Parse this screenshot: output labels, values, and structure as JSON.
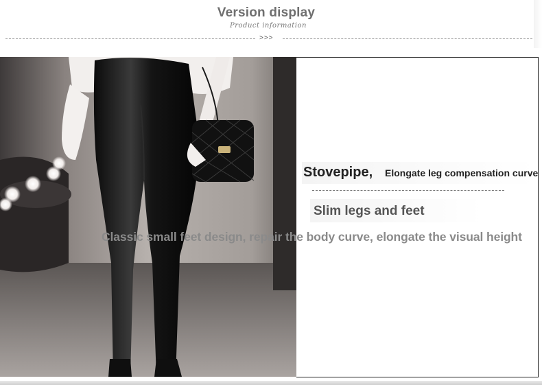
{
  "header": {
    "title": "Version display",
    "subtitle_script": "Product information",
    "arrows": ">>>"
  },
  "product": {
    "title": "Stovepipe,",
    "side_title": "Elongate leg compensation curve",
    "subtitle": "Slim legs and feet",
    "description": "Classic small feet design, repair the body curve, elongate the visual height"
  }
}
